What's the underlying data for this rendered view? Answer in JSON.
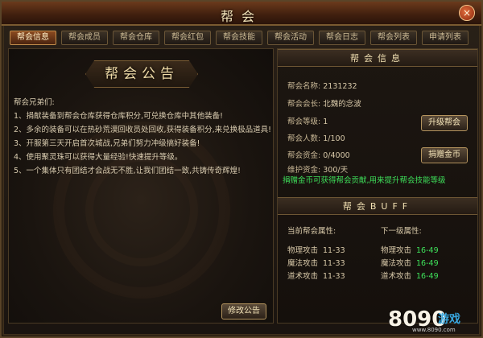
{
  "window": {
    "title": "帮会",
    "close_icon": "×"
  },
  "tabs": [
    {
      "label": "帮会信息",
      "active": true
    },
    {
      "label": "帮会成员"
    },
    {
      "label": "帮会仓库"
    },
    {
      "label": "帮会红包"
    },
    {
      "label": "帮会技能"
    },
    {
      "label": "帮会活动"
    },
    {
      "label": "帮会日志"
    },
    {
      "label": "帮会列表"
    },
    {
      "label": "申请列表"
    }
  ],
  "notice": {
    "banner": "帮会公告",
    "lines": [
      "帮会兄弟们:",
      "1、捐献装备到帮会仓库获得仓库积分,可兑换仓库中其他装备!",
      "2、多余的装备可以在热砂荒漠回收员处回收,获得装备积分,来兑换极品道具!",
      "3、开服第三天开启首次城战,兄弟们努力冲级搞好装备!",
      "4、使用聚灵珠可以获得大量经验!快速提升等级。",
      "5、一个集体只有团结才会战无不胜,让我们团结一致,共铸传奇辉煌!"
    ],
    "edit_button": "修改公告"
  },
  "guild_info": {
    "header": "帮会信息",
    "rows": [
      {
        "label": "帮会名称:",
        "value": "2131232"
      },
      {
        "label": "帮会会长:",
        "value": "北魏的念波"
      },
      {
        "label": "帮会等级:",
        "value": "1"
      },
      {
        "label": "帮会人数:",
        "value": "1/100"
      },
      {
        "label": "帮会资金:",
        "value": "0/4000"
      },
      {
        "label": "维护资金:",
        "value": "300/天"
      }
    ],
    "upgrade_button": "升级帮会",
    "donate_button": "捐赠金币",
    "note": "捐赠金币可获得帮会贡献,用来提升帮会技能等级"
  },
  "buff": {
    "header": "帮会BUFF",
    "current_title": "当前帮会属性:",
    "next_title": "下一级属性:",
    "current": [
      {
        "label": "物理攻击",
        "value": "11-33"
      },
      {
        "label": "魔法攻击",
        "value": "11-33"
      },
      {
        "label": "道术攻击",
        "value": "11-33"
      }
    ],
    "next": [
      {
        "label": "物理攻击",
        "value": "16-49"
      },
      {
        "label": "魔法攻击",
        "value": "16-49"
      },
      {
        "label": "道术攻击",
        "value": "16-49"
      }
    ]
  },
  "watermark": {
    "number": "8090",
    "text": "游戏",
    "url": "www.8090.com"
  }
}
